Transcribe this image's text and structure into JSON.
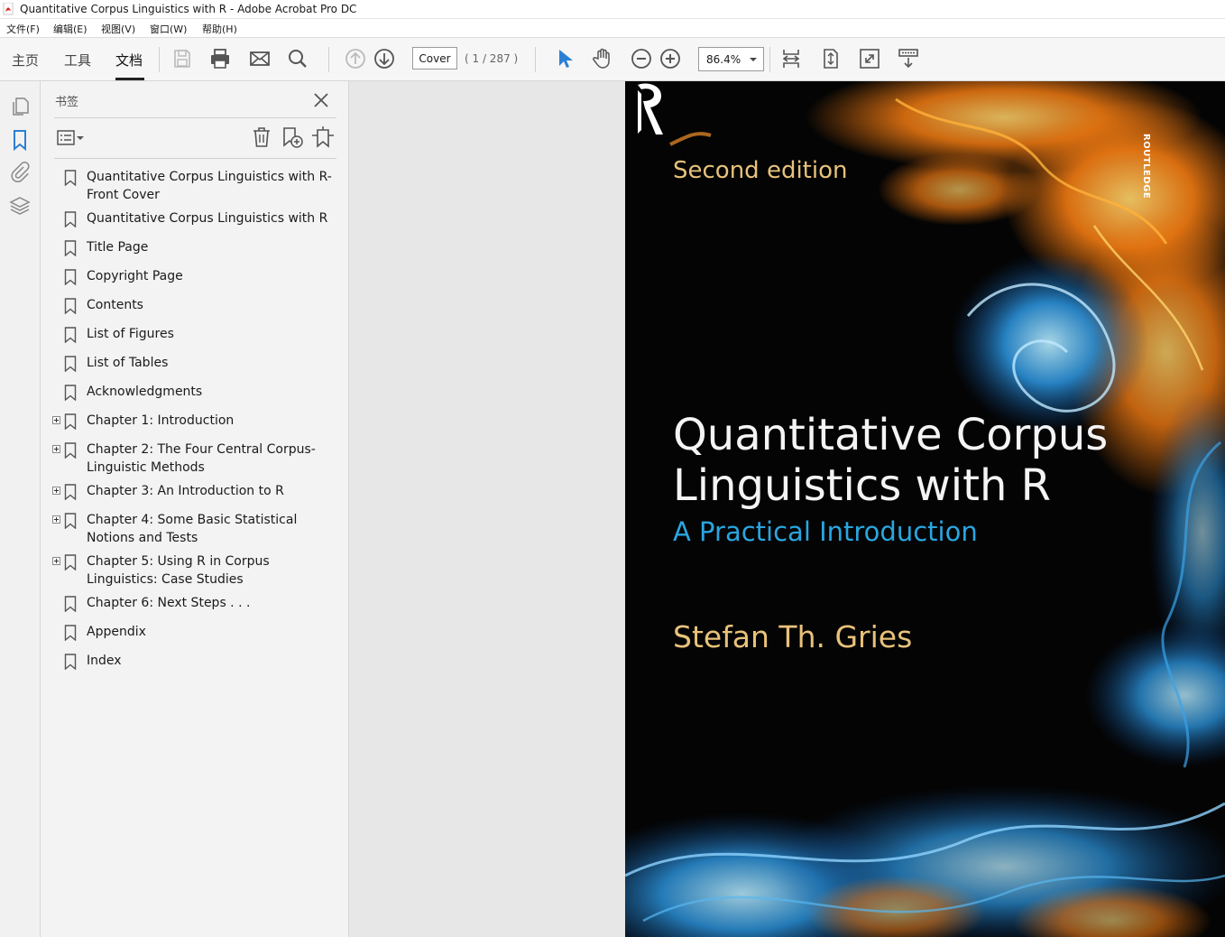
{
  "window": {
    "title": "Quantitative Corpus Linguistics with R - Adobe Acrobat Pro DC"
  },
  "menu": {
    "items": [
      "文件(F)",
      "编辑(E)",
      "视图(V)",
      "窗口(W)",
      "帮助(H)"
    ]
  },
  "toolbar": {
    "tabs": [
      "主页",
      "工具",
      "文档"
    ],
    "active_tab": "文档",
    "page_field": "Cover",
    "page_count": "( 1 / 287 )",
    "zoom": "86.4%",
    "icons": [
      "save-icon",
      "print-icon",
      "email-icon",
      "search-icon",
      "prev-page-icon",
      "next-page-icon",
      "select-cursor-icon",
      "hand-icon",
      "zoom-out-icon",
      "zoom-in-icon",
      "scroll-mode-icon",
      "fit-page-icon",
      "full-screen-icon",
      "read-mode-icon"
    ]
  },
  "left_rail": {
    "icons": [
      "pages-icon",
      "bookmark-icon",
      "attachment-icon",
      "layers-icon"
    ],
    "active": "bookmark-icon"
  },
  "bookmarks": {
    "panel_title": "书签",
    "items": [
      {
        "label": "Quantitative Corpus Linguistics with R- Front Cover",
        "expandable": false
      },
      {
        "label": "Quantitative Corpus Linguistics with R",
        "expandable": false
      },
      {
        "label": "Title Page",
        "expandable": false
      },
      {
        "label": "Copyright Page",
        "expandable": false
      },
      {
        "label": "Contents",
        "expandable": false
      },
      {
        "label": "List of Figures",
        "expandable": false
      },
      {
        "label": "List of Tables",
        "expandable": false
      },
      {
        "label": "Acknowledgments",
        "expandable": false
      },
      {
        "label": "Chapter 1: Introduction",
        "expandable": true
      },
      {
        "label": "Chapter 2: The Four Central Corpus-Linguistic Methods",
        "expandable": true
      },
      {
        "label": "Chapter 3: An Introduction to R",
        "expandable": true
      },
      {
        "label": "Chapter 4: Some Basic Statistical Notions and Tests",
        "expandable": true
      },
      {
        "label": "Chapter 5: Using R in Corpus Linguistics: Case Studies",
        "expandable": true
      },
      {
        "label": "Chapter 6: Next Steps . . .",
        "expandable": false
      },
      {
        "label": "Appendix",
        "expandable": false
      },
      {
        "label": "Index",
        "expandable": false
      }
    ]
  },
  "cover": {
    "edition": "Second edition",
    "title_line1": "Quantitative Corpus",
    "title_line2": "Linguistics with R",
    "subtitle": "A Practical Introduction",
    "author": "Stefan Th. Gries",
    "publisher": "ROUTLEDGE"
  },
  "colors": {
    "accent_blue": "#2d7fd4",
    "cover_gold": "#e8c27a",
    "cover_subtitle_blue": "#2aa6e0",
    "cover_background": "#040404"
  }
}
